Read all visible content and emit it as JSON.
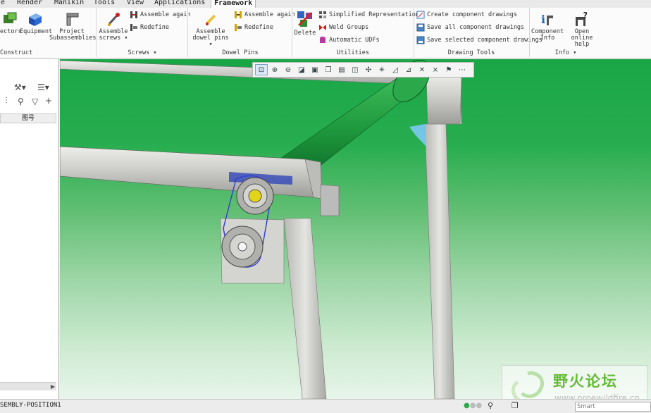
{
  "menu_tabs": [
    "e",
    "Render",
    "Manikin",
    "Tools",
    "View",
    "Applications",
    "Framework"
  ],
  "ribbon": {
    "construct": {
      "btn1": "ectors",
      "btn2": "Equipment",
      "btn3_l1": "Project",
      "btn3_l2": "Subassemblies",
      "label": "Construct"
    },
    "screws": {
      "big_l1": "Assemble",
      "big_l2": "screws ▾",
      "again": "Assemble again",
      "redefine": "Redefine",
      "label": "Screws ▾"
    },
    "dowel": {
      "big_l1": "Assemble",
      "big_l2": "dowel pins ▾",
      "again": "Assemble again",
      "redefine": "Redefine",
      "label": "Dowel Pins"
    },
    "utilities": {
      "delete": "Delete",
      "simplified": "Simplified Representations",
      "weld": "Weld Groups",
      "udf": "Automatic UDFs",
      "label": "Utilities"
    },
    "drawing": {
      "create": "Create component drawings",
      "save_all": "Save all component drawings",
      "save_sel": "Save selected component drawings",
      "label": "Drawing Tools"
    },
    "info": {
      "comp_l1": "Component",
      "comp_l2": "Info",
      "help_l1": "Open online",
      "help_l2": "help",
      "label": "Info ▾"
    }
  },
  "left_panel": {
    "column_header": "图号"
  },
  "status": {
    "left_text": "SEMBLY-POSITION1",
    "smart_text": "Smart"
  },
  "watermark": {
    "cn": "野火论坛",
    "url": "www.proewildfire.cn"
  },
  "colors": {
    "viewport_green": "#19a646",
    "frame_gray": "#cfd0cc",
    "roller_green": "#1f9a3e",
    "chain_blue": "#3742c8"
  }
}
